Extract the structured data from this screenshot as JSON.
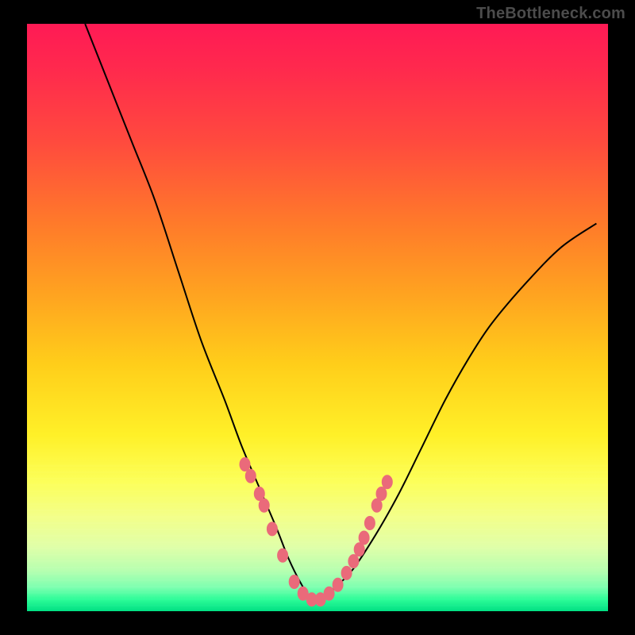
{
  "watermark": "TheBottleneck.com",
  "colors": {
    "frame": "#000000",
    "dot": "#ea6a7a",
    "curve": "#000000",
    "gradient_top": "#ff1a55",
    "gradient_bottom": "#00e083"
  },
  "chart_data": {
    "type": "line",
    "title": "",
    "xlabel": "",
    "ylabel": "",
    "xlim": [
      0,
      100
    ],
    "ylim": [
      0,
      100
    ],
    "grid": false,
    "legend": false,
    "series": [
      {
        "name": "bottleneck-curve",
        "x": [
          10,
          14,
          18,
          22,
          26,
          30,
          34,
          37,
          40,
          43,
          45,
          47,
          49,
          51,
          53,
          56,
          60,
          64,
          68,
          72,
          76,
          80,
          86,
          92,
          98
        ],
        "y": [
          100,
          90,
          80,
          70,
          58,
          46,
          36,
          28,
          21,
          14,
          9,
          5,
          2,
          2,
          4,
          7,
          13,
          20,
          28,
          36,
          43,
          49,
          56,
          62,
          66
        ]
      }
    ],
    "markers": {
      "name": "highlight-dots",
      "note": "salmon dots clustered near valley and lower flanks",
      "x": [
        37.5,
        38.5,
        40.0,
        40.8,
        42.2,
        44.0,
        46.0,
        47.5,
        49.0,
        50.5,
        52.0,
        53.5,
        55.0,
        56.2,
        57.2,
        58.0,
        59.0,
        60.2,
        61.0,
        62.0
      ],
      "y": [
        25.0,
        23.0,
        20.0,
        18.0,
        14.0,
        9.5,
        5.0,
        3.0,
        2.0,
        2.0,
        3.0,
        4.5,
        6.5,
        8.5,
        10.5,
        12.5,
        15.0,
        18.0,
        20.0,
        22.0
      ]
    }
  }
}
